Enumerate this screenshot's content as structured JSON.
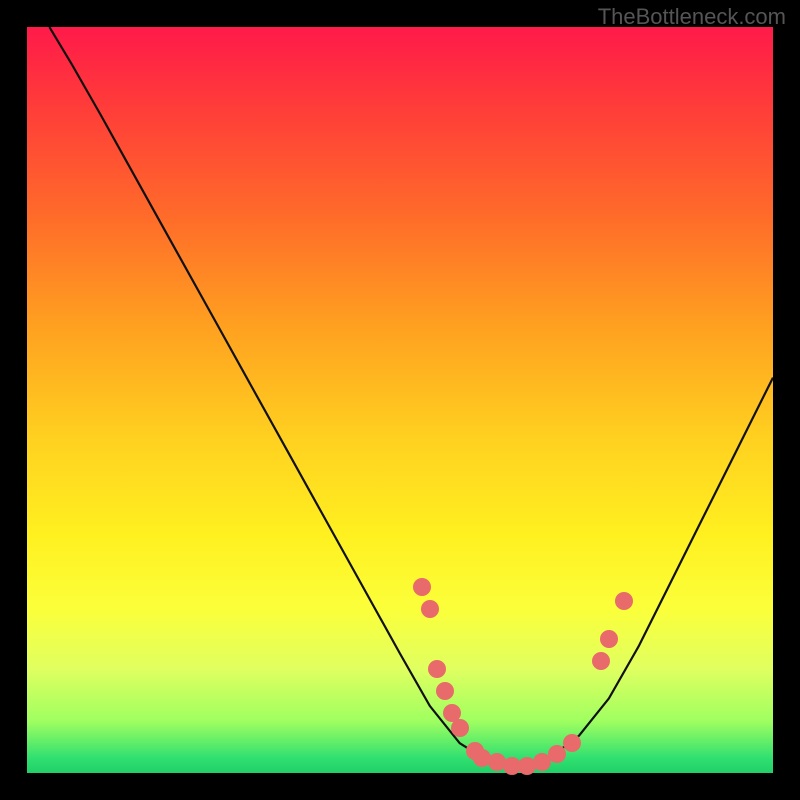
{
  "watermark": "TheBottleneck.com",
  "chart_data": {
    "type": "line",
    "title": "",
    "xlabel": "",
    "ylabel": "",
    "xlim": [
      0,
      100
    ],
    "ylim": [
      0,
      100
    ],
    "grid": false,
    "curve": [
      {
        "x": 3,
        "y": 100
      },
      {
        "x": 6,
        "y": 95
      },
      {
        "x": 10,
        "y": 88
      },
      {
        "x": 15,
        "y": 79
      },
      {
        "x": 20,
        "y": 70
      },
      {
        "x": 25,
        "y": 61
      },
      {
        "x": 30,
        "y": 52
      },
      {
        "x": 35,
        "y": 43
      },
      {
        "x": 40,
        "y": 34
      },
      {
        "x": 45,
        "y": 25
      },
      {
        "x": 50,
        "y": 16
      },
      {
        "x": 54,
        "y": 9
      },
      {
        "x": 58,
        "y": 4
      },
      {
        "x": 62,
        "y": 1.5
      },
      {
        "x": 66,
        "y": 1
      },
      {
        "x": 70,
        "y": 2
      },
      {
        "x": 74,
        "y": 5
      },
      {
        "x": 78,
        "y": 10
      },
      {
        "x": 82,
        "y": 17
      },
      {
        "x": 86,
        "y": 25
      },
      {
        "x": 90,
        "y": 33
      },
      {
        "x": 95,
        "y": 43
      },
      {
        "x": 100,
        "y": 53
      }
    ],
    "dots": [
      {
        "x": 53,
        "y": 25
      },
      {
        "x": 54,
        "y": 22
      },
      {
        "x": 55,
        "y": 14
      },
      {
        "x": 56,
        "y": 11
      },
      {
        "x": 57,
        "y": 8
      },
      {
        "x": 58,
        "y": 6
      },
      {
        "x": 60,
        "y": 3
      },
      {
        "x": 61,
        "y": 2
      },
      {
        "x": 63,
        "y": 1.5
      },
      {
        "x": 65,
        "y": 1
      },
      {
        "x": 67,
        "y": 1
      },
      {
        "x": 69,
        "y": 1.5
      },
      {
        "x": 71,
        "y": 2.5
      },
      {
        "x": 73,
        "y": 4
      },
      {
        "x": 77,
        "y": 15
      },
      {
        "x": 78,
        "y": 18
      },
      {
        "x": 80,
        "y": 23
      }
    ],
    "dot_color": "#e86a6a"
  }
}
